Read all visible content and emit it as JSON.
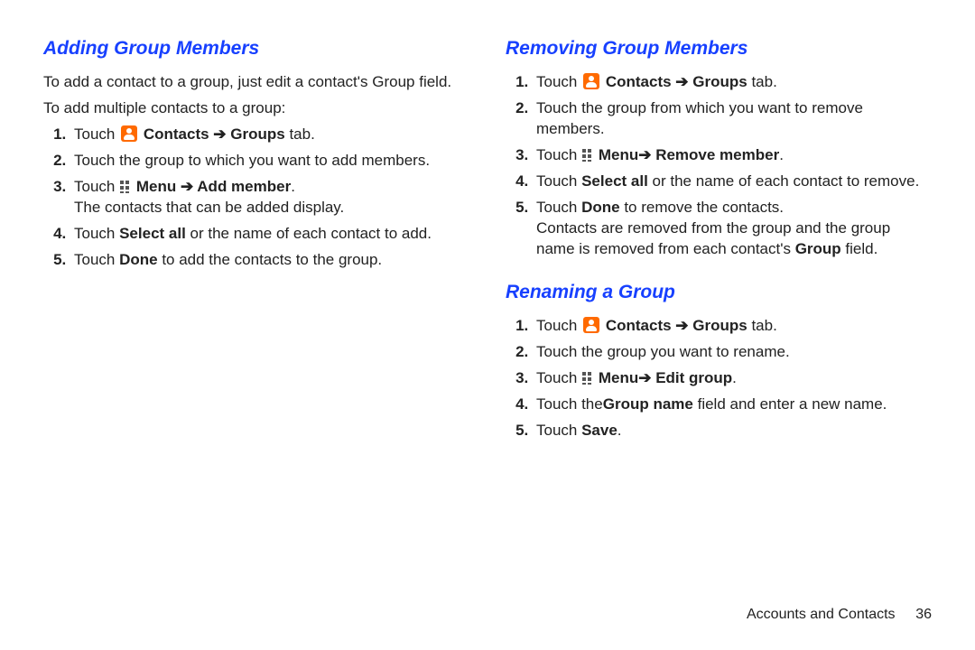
{
  "left": {
    "heading": "Adding Group Members",
    "intro1": "To add a contact to a group, just edit a contact's Group field.",
    "intro2": "To add multiple contacts to a group:",
    "step1_pre": "Touch ",
    "step1_contacts": "Contacts",
    "step1_arrow": " ➔ ",
    "step1_groups": "Groups",
    "step1_suffix": " tab.",
    "step2": "Touch the group to which you want to add members.",
    "step3_pre": "Touch ",
    "step3_menu": "Menu",
    "step3_arrow": " ➔ ",
    "step3_action": "Add member",
    "step3_suffix": ".",
    "step3_note": "The contacts that can be added display.",
    "step4_pre": "Touch ",
    "step4_bold": "Select all",
    "step4_suffix": " or the name of each contact to add.",
    "step5_pre": "Touch ",
    "step5_bold": "Done",
    "step5_suffix": " to add the contacts to the group."
  },
  "right1": {
    "heading": "Removing Group Members",
    "step1_pre": "Touch ",
    "step1_contacts": "Contacts",
    "step1_arrow": " ➔ ",
    "step1_groups": "Groups",
    "step1_suffix": " tab.",
    "step2": "Touch the group from which you want to remove members.",
    "step3_pre": "Touch ",
    "step3_menu": "Menu",
    "step3_arrow": "➔  ",
    "step3_action": "Remove member",
    "step3_suffix": ".",
    "step4_pre": "Touch ",
    "step4_bold": "Select all",
    "step4_suffix": " or the name of each contact to remove.",
    "step5_pre": "Touch ",
    "step5_bold": "Done",
    "step5_suffix": " to remove the contacts.",
    "note_a": "Contacts are removed from the group and the group name is removed from each contact's ",
    "note_bold": "Group",
    "note_b": " field."
  },
  "right2": {
    "heading": "Renaming a Group",
    "step1_pre": "Touch ",
    "step1_contacts": "Contacts",
    "step1_arrow": " ➔ ",
    "step1_groups": "Groups",
    "step1_suffix": " tab.",
    "step2": "Touch the group you want to rename.",
    "step3_pre": "Touch ",
    "step3_menu": "Menu",
    "step3_arrow": "➔  ",
    "step3_action": "Edit group",
    "step3_suffix": ".",
    "step4_pre": "Touch the",
    "step4_bold": "Group name ",
    "step4_suffix": " field and enter a new name.",
    "step5_pre": "Touch ",
    "step5_bold": "Save",
    "step5_suffix": "."
  },
  "footer": {
    "chapter": "Accounts and Contacts",
    "page": "36"
  }
}
